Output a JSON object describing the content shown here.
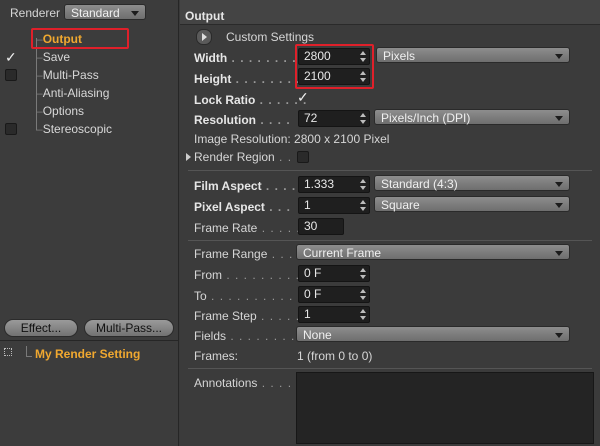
{
  "left": {
    "renderer_label": "Renderer",
    "renderer_value": "Standard",
    "items": [
      {
        "label": "Output"
      },
      {
        "label": "Save"
      },
      {
        "label": "Multi-Pass"
      },
      {
        "label": "Anti-Aliasing"
      },
      {
        "label": "Options"
      },
      {
        "label": "Stereoscopic"
      }
    ],
    "effect_button": "Effect...",
    "multipass_button": "Multi-Pass...",
    "render_setting": "My Render Setting"
  },
  "main": {
    "title": "Output",
    "custom_settings": "Custom Settings",
    "width_label": "Width",
    "width_value": "2800",
    "units_value": "Pixels",
    "height_label": "Height",
    "height_value": "2100",
    "lock_ratio_label": "Lock Ratio",
    "resolution_label": "Resolution",
    "resolution_value": "72",
    "resolution_units": "Pixels/Inch (DPI)",
    "image_resolution": "Image Resolution: 2800 x 2100 Pixel",
    "render_region_label": "Render Region",
    "film_aspect_label": "Film Aspect",
    "film_aspect_value": "1.333",
    "film_aspect_preset": "Standard (4:3)",
    "pixel_aspect_label": "Pixel Aspect",
    "pixel_aspect_value": "1",
    "pixel_aspect_preset": "Square",
    "frame_rate_label": "Frame Rate",
    "frame_rate_value": "30",
    "frame_range_label": "Frame Range",
    "frame_range_value": "Current Frame",
    "from_label": "From",
    "from_value": "0 F",
    "to_label": "To",
    "to_value": "0 F",
    "frame_step_label": "Frame Step",
    "frame_step_value": "1",
    "fields_label": "Fields",
    "fields_value": "None",
    "frames_label": "Frames:",
    "frames_value": "1 (from 0 to 0)",
    "annotations_label": "Annotations"
  },
  "colors": {
    "active_item": "#f0a830",
    "highlight_box": "#e0202a"
  }
}
